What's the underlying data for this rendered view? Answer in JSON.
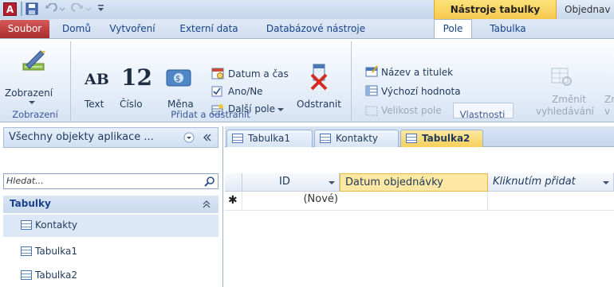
{
  "title_bar": {
    "app_icon_letter": "A",
    "contextual_group": "Nástroje tabulky",
    "next_title": "Objednav"
  },
  "tabs": {
    "file": "Soubor",
    "items": [
      "Domů",
      "Vytvoření",
      "Externí data",
      "Databázové nástroje",
      "Pole",
      "Tabulka"
    ],
    "active": "Pole"
  },
  "ribbon": {
    "views": {
      "button": "Zobrazení",
      "group_label": "Zobrazení"
    },
    "add_delete": {
      "text_button": "Text",
      "text_glyph": "AB",
      "number_button": "Číslo",
      "number_glyph": "12",
      "currency_button": "Měna",
      "date_time": "Datum a čas",
      "yes_no": "Ano/Ne",
      "more_fields": "Další pole",
      "delete_button": "Odstranit",
      "group_label": "Přidat a odstranit"
    },
    "properties": {
      "name_caption": "Název a titulek",
      "default_value": "Výchozí hodnota",
      "field_size": "Velikost pole",
      "field_size_value": "",
      "modify_lookups_line1": "Změnit",
      "modify_lookups_line2": "vyhledávání",
      "cut_label_top": "Zr",
      "cut_label_bottom": "v",
      "group_label": "Vlastnosti"
    }
  },
  "nav_pane": {
    "header": "Všechny objekty aplikace ...",
    "search_placeholder": "Hledat...",
    "group": "Tabulky",
    "items": [
      "Kontakty",
      "Tabulka1",
      "Tabulka2"
    ]
  },
  "document_tabs": [
    {
      "label": "Tabulka1",
      "active": false
    },
    {
      "label": "Kontakty",
      "active": false
    },
    {
      "label": "Tabulka2",
      "active": true
    }
  ],
  "datasheet": {
    "columns": [
      "ID",
      "Datum objednávky",
      "Kliknutím přidat"
    ],
    "new_row_marker": "✱",
    "new_row_id": "(Nové)"
  }
}
